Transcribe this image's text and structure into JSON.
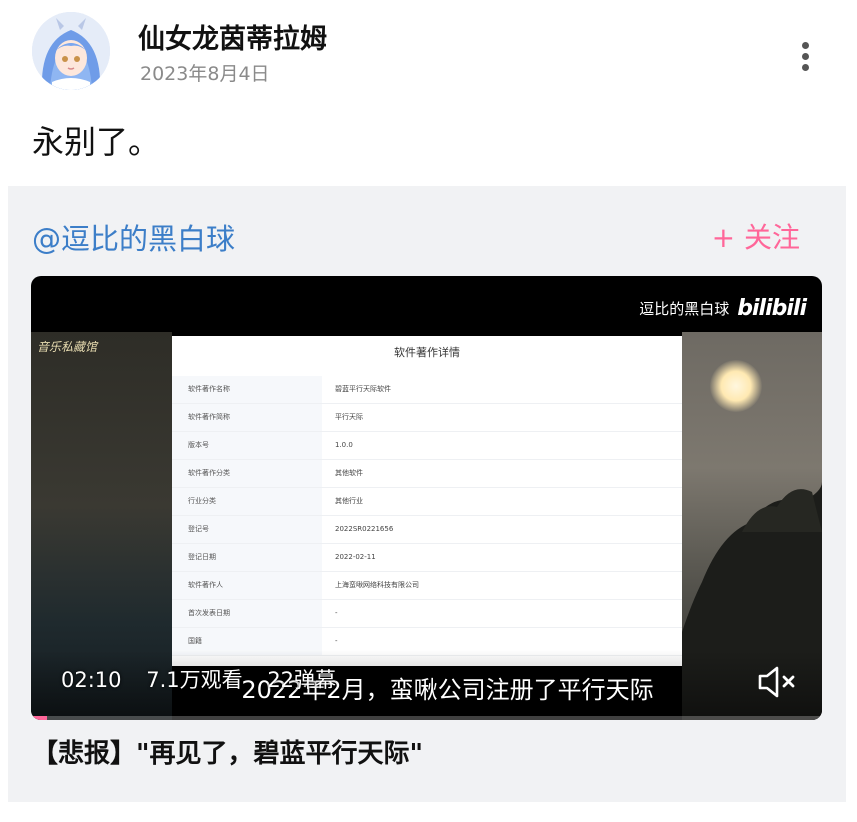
{
  "post": {
    "author": "仙女龙茵蒂拉姆",
    "date": "2023年8月4日",
    "text": "永别了。"
  },
  "shared": {
    "uploader": "@逗比的黑白球",
    "follow_label": "+ 关注",
    "video": {
      "watermark_text": "逗比的黑白球",
      "watermark_logo": "bilibili",
      "left_sign": "音乐私藏馆",
      "duration": "02:10",
      "views": "7.1万观看",
      "danmaku": "22弹幕",
      "subtitle": "2022年2月，蛮啾公司注册了平行天际",
      "progress": 0.02,
      "doc": {
        "title": "软件著作详情",
        "rows": [
          {
            "k": "软件著作名称",
            "v": "碧蓝平行天际软件"
          },
          {
            "k": "软件著作简称",
            "v": "平行天际"
          },
          {
            "k": "版本号",
            "v": "1.0.0"
          },
          {
            "k": "软件著作分类",
            "v": "其他软件"
          },
          {
            "k": "行业分类",
            "v": "其他行业"
          },
          {
            "k": "登记号",
            "v": "2022SR0221656"
          },
          {
            "k": "登记日期",
            "v": "2022-02-11"
          },
          {
            "k": "软件著作人",
            "v": "上海蛮啾网络科技有限公司"
          },
          {
            "k": "首次发表日期",
            "v": "-"
          },
          {
            "k": "国籍",
            "v": "-"
          }
        ]
      }
    },
    "title": "【悲报】\"再见了，碧蓝平行天际\""
  },
  "icons": {
    "more": "more-vertical-icon",
    "mute": "volume-mute-icon"
  },
  "colors": {
    "link": "#3c7ec8",
    "accent": "#ff6699"
  }
}
